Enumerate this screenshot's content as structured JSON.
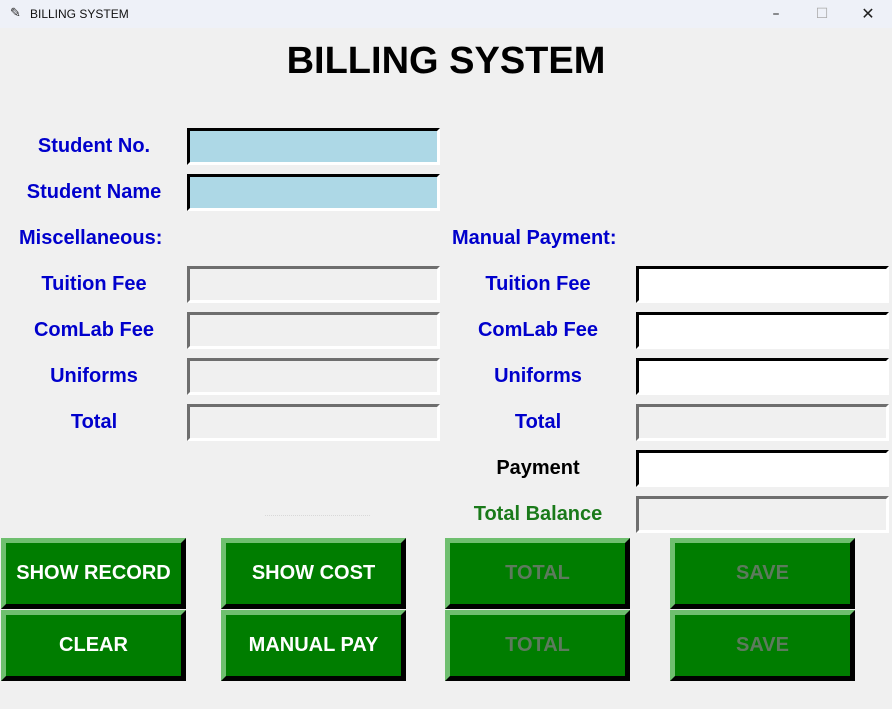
{
  "window": {
    "title": "BILLING SYSTEM",
    "controls": {
      "minimize": "–",
      "maximize": "☐",
      "close": "✕"
    },
    "icon": "feather-icon"
  },
  "heading": "BILLING SYSTEM",
  "student": {
    "number_label": "Student No.",
    "name_label": "Student Name",
    "number_value": "",
    "name_value": ""
  },
  "misc": {
    "section_label": "Miscellaneous:",
    "tuition_label": "Tuition Fee",
    "comlab_label": "ComLab Fee",
    "uniforms_label": "Uniforms",
    "total_label": "Total"
  },
  "manual": {
    "section_label": "Manual Payment:",
    "tuition_label": "Tuition Fee",
    "comlab_label": "ComLab Fee",
    "uniforms_label": "Uniforms",
    "total_label": "Total",
    "payment_label": "Payment",
    "balance_label": "Total Balance"
  },
  "buttons": {
    "show_record": "SHOW RECORD",
    "show_cost": "SHOW COST",
    "total_1": "TOTAL",
    "save_1": "SAVE",
    "clear": "CLEAR",
    "manual_pay": "MANUAL PAY",
    "total_2": "TOTAL",
    "save_2": "SAVE"
  },
  "colors": {
    "label_blue": "#0000cc",
    "balance_green": "#1a7a1a",
    "button_green": "#007d00",
    "entry_blue": "#add8e6"
  }
}
